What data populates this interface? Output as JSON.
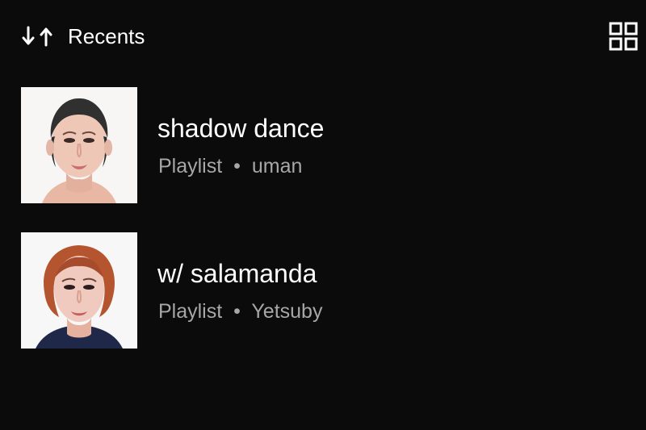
{
  "header": {
    "sort_label": "Recents",
    "sort_icon": "sort-arrows-icon",
    "view_toggle_icon": "grid-view-icon"
  },
  "library": {
    "items": [
      {
        "title": "shadow dance",
        "type": "Playlist",
        "separator": "•",
        "owner": "uman"
      },
      {
        "title": "w/ salamanda",
        "type": "Playlist",
        "separator": "•",
        "owner": "Yetsuby"
      }
    ]
  },
  "colors": {
    "background": "#0b0b0b",
    "primary_text": "#ffffff",
    "secondary_text": "#a7a7a7"
  }
}
